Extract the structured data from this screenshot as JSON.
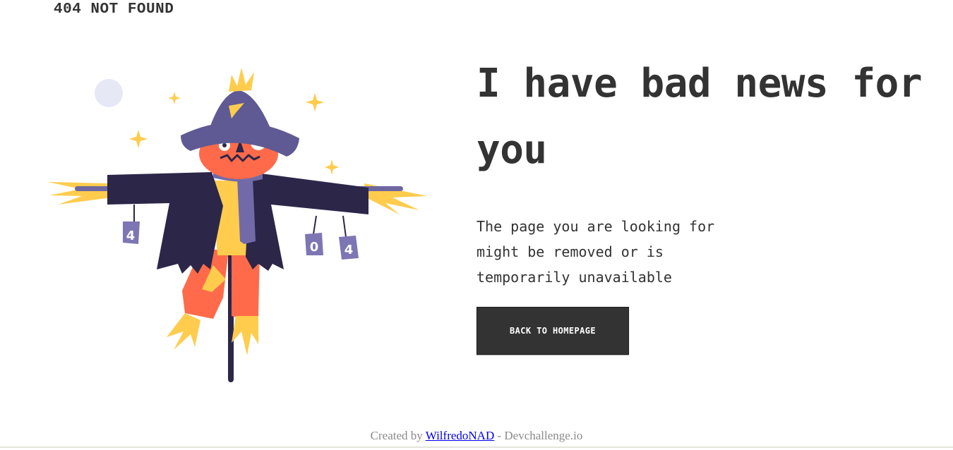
{
  "header": {
    "brand": "404 NOT FOUND"
  },
  "hero": {
    "title": "I have bad news for you",
    "message": "The page you are looking for might be removed or is temporarily unavailable",
    "button_label": "BACK TO HOMEPAGE"
  },
  "illustration": {
    "can_left": "4",
    "can_middle": "0",
    "can_right": "4",
    "colors": {
      "hat": "#5f5a94",
      "coat": "#2c2649",
      "face": "#ff6b4a",
      "straw": "#ffcc4d",
      "scarf": "#726aa8",
      "moon": "#e6e8f6",
      "can": "#7c76b4"
    }
  },
  "footer": {
    "prefix": "Created by ",
    "author": "WilfredoNAD",
    "suffix": " - Devchallenge.io"
  },
  "colors": {
    "text": "#333333",
    "button_bg": "#333333",
    "button_text": "#ffffff",
    "link": "#0000ee",
    "footer_text": "#8a8a8a"
  }
}
